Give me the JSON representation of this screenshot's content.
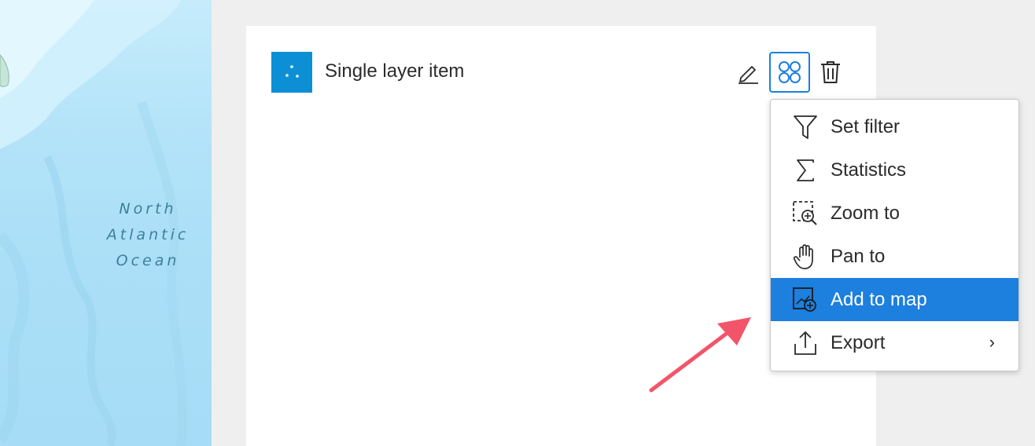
{
  "map": {
    "ocean_label": [
      "North",
      "Atlantic",
      "Ocean"
    ]
  },
  "layer": {
    "title": "Single layer item",
    "thumb_color": "#0d8fd6"
  },
  "toolbar": {
    "edit_icon": "pencil-icon",
    "actions_icon": "grid-circles-icon",
    "delete_icon": "trash-icon"
  },
  "menu": {
    "items": [
      {
        "label": "Set filter",
        "icon": "filter-icon"
      },
      {
        "label": "Statistics",
        "icon": "sigma-icon"
      },
      {
        "label": "Zoom to",
        "icon": "zoom-to-icon"
      },
      {
        "label": "Pan to",
        "icon": "hand-icon"
      },
      {
        "label": "Add to map",
        "icon": "add-to-map-icon",
        "highlighted": true
      },
      {
        "label": "Export",
        "icon": "export-icon",
        "submenu": "›"
      }
    ]
  },
  "colors": {
    "accent": "#1d7fde",
    "annotation_arrow": "#f2556a"
  }
}
